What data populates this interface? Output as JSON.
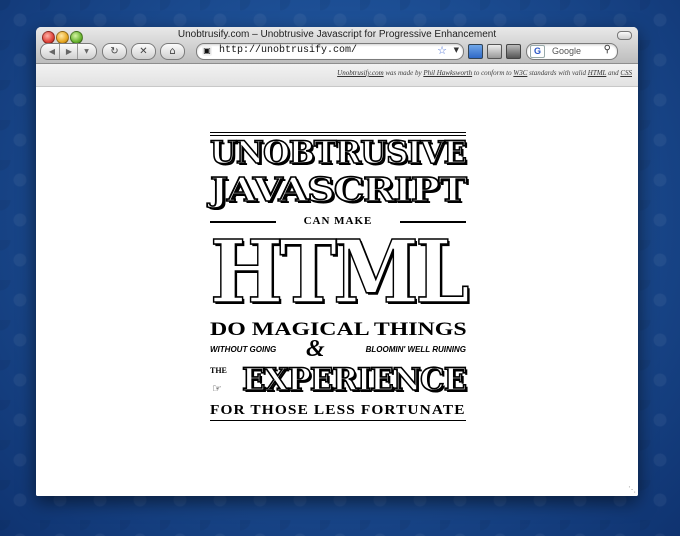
{
  "window": {
    "title": "Unobtrusify.com – Unobtrusive Javascript for Progressive Enhancement"
  },
  "toolbar": {
    "back_icon": "back-arrow-icon",
    "forward_icon": "forward-arrow-icon",
    "reload_icon": "reload-icon",
    "stop_icon": "stop-icon",
    "home_icon": "home-icon",
    "url": "http://unobtrusify.com/",
    "search_placeholder": "Google",
    "search_engine": "G"
  },
  "credits": {
    "site": "Unobtrusify.com",
    "made_by": "was made by",
    "author": "Phil Hawksworth",
    "conform": "to conform to",
    "w3c": "W3C",
    "standards": "standards with valid",
    "html": "HTML",
    "and": "and",
    "css": "CSS"
  },
  "poster": {
    "line1": "UNOBTRUSIVE",
    "line2": "JAVASCRIPT",
    "line3": "CAN MAKE",
    "line4": "HTML",
    "line5": "DO MAGICAL THINGS",
    "small_left": "WITHOUT GOING",
    "amp": "&",
    "small_right": "BLOOMIN' WELL RUINING",
    "the": "THE",
    "line6": "EXPERIENCE",
    "line7": "FOR THOSE LESS FORTUNATE"
  }
}
